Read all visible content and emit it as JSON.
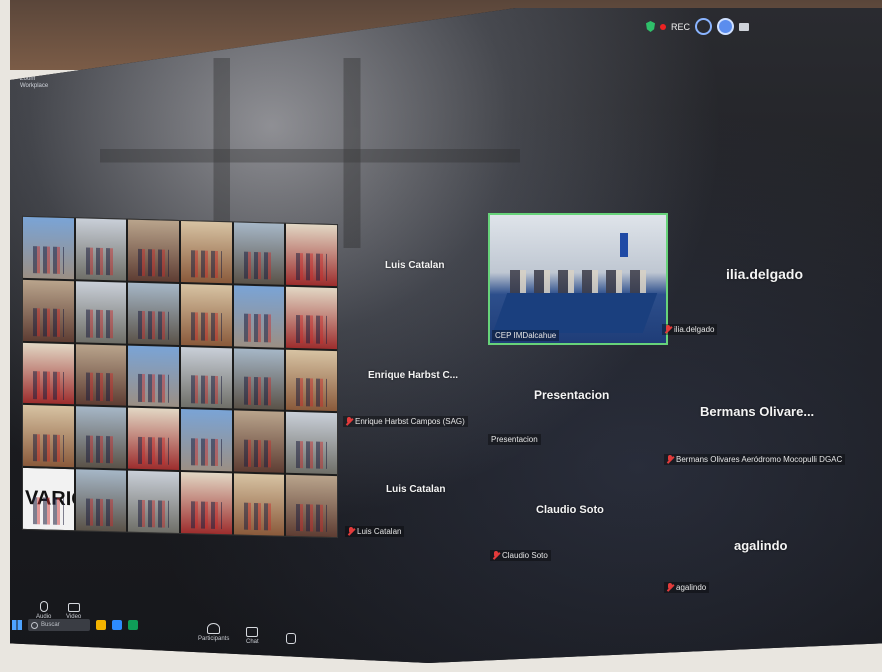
{
  "window": {
    "title": "Zoom Workplace"
  },
  "topbar": {
    "rec_label": "REC"
  },
  "shared_screen": {
    "label": "VARIOS"
  },
  "participants": [
    {
      "key": "luis1",
      "tile_name": "Luis Catalan",
      "label": ""
    },
    {
      "key": "ilia",
      "tile_name": "ilia.delgado",
      "label": "ilia.delgado"
    },
    {
      "key": "enrique",
      "tile_name": "Enrique Harbst C...",
      "label": "Enrique Harbst Campos (SAG)"
    },
    {
      "key": "presentacion",
      "tile_name": "Presentacion",
      "label": "Presentacion"
    },
    {
      "key": "bermans",
      "tile_name": "Bermans Olivare...",
      "label": "Bermans Olivares Aeródromo Mocopulli DGAC"
    },
    {
      "key": "luis2",
      "tile_name": "Luis Catalan",
      "label": "Luis Catalan"
    },
    {
      "key": "claudio",
      "tile_name": "Claudio Soto",
      "label": "Claudio Soto"
    },
    {
      "key": "agalindo",
      "tile_name": "agalindo",
      "label": "agalindo"
    }
  ],
  "video_tile": {
    "label": "CEP IMDalcahue"
  },
  "toolbar": {
    "audio": "Audio",
    "video": "Video",
    "participants": "Participants",
    "chat": "Chat"
  },
  "taskbar": {
    "search_placeholder": "Buscar"
  },
  "colors": {
    "active_speaker_border": "#67d37a",
    "muted_icon": "#e23b3b",
    "rec_dot": "#e22222"
  }
}
